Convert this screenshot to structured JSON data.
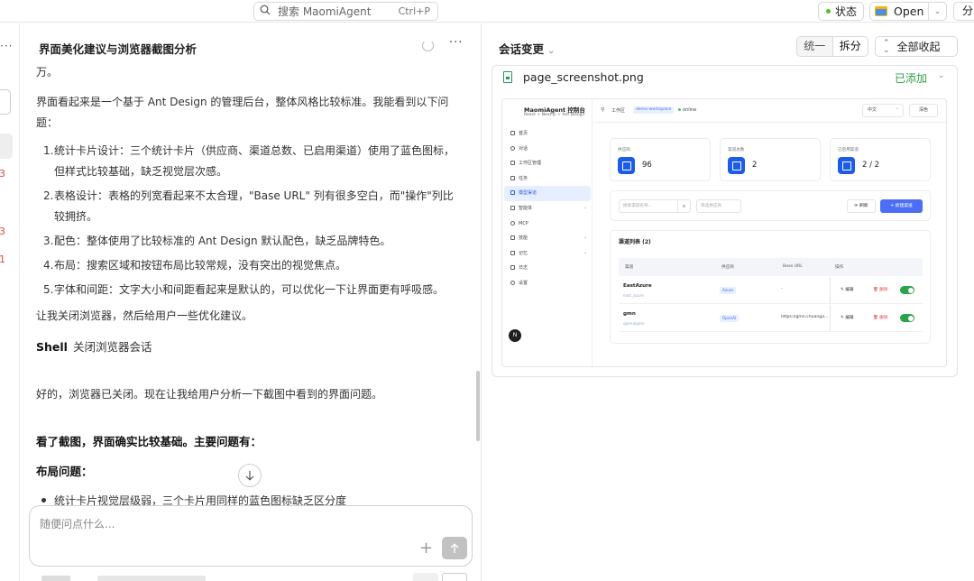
{
  "topbar": {
    "search_placeholder": "搜索 MaomiAgent",
    "search_shortcut": "Ctrl+P",
    "status_label": "状态",
    "open_label": "Open",
    "share_label": "分"
  },
  "left_strip": {
    "numbers": [
      "3",
      "3",
      "1"
    ]
  },
  "chat": {
    "title": "界面美化建议与浏览器截图分析",
    "p0": "万。",
    "p1": "界面看起来是一个基于 Ant Design 的管理后台，整体风格比较标准。我能看到以下问题：",
    "issues": [
      {
        "num": "1.",
        "text": "统计卡片设计：三个统计卡片（供应商、渠道总数、已启用渠道）使用了蓝色图标，但样式比较基础，缺乏视觉层次感。"
      },
      {
        "num": "2.",
        "text": "表格设计：表格的列宽看起来不太合理，\"Base URL\" 列有很多空白，而\"操作\"列比较拥挤。"
      },
      {
        "num": "3.",
        "text": "配色：整体使用了比较标准的 Ant Design 默认配色，缺乏品牌特色。"
      },
      {
        "num": "4.",
        "text": "布局：搜索区域和按钮布局比较常规，没有突出的视觉焦点。"
      },
      {
        "num": "5.",
        "text": "字体和间距：文字大小和间距看起来是默认的，可以优化一下让界面更有呼吸感。"
      }
    ],
    "p2": "让我关闭浏览器，然后给用户一些优化建议。",
    "shell_label": "Shell",
    "shell_text": "关闭浏览器会话",
    "p3": "好的，浏览器已关闭。现在让我给用户分析一下截图中看到的界面问题。",
    "p4": "看了截图，界面确实比较基础。主要问题有：",
    "p5": "布局问题：",
    "bullet1": "统计卡片视觉层级弱，三个卡片用同样的蓝色图标缺乏区分度",
    "composer_placeholder": "随便问点什么..."
  },
  "right": {
    "title": "会话变更",
    "seg_unified": "统一",
    "seg_split": "拆分",
    "collapse_all": "全部收起",
    "file_name": "page_screenshot.png",
    "file_status": "已添加"
  },
  "mini": {
    "logo": "MaomiAgent 控制台",
    "logo_sub": "React + Next.js + Ant Design",
    "nav": [
      {
        "label": "首页",
        "arrow": ""
      },
      {
        "label": "对话",
        "arrow": ""
      },
      {
        "label": "工作区管理",
        "arrow": ""
      },
      {
        "label": "任务",
        "arrow": ""
      },
      {
        "label": "模型渠道",
        "arrow": ""
      },
      {
        "label": "智能体",
        "arrow": "⌄"
      },
      {
        "label": "MCP",
        "arrow": ""
      },
      {
        "label": "技能",
        "arrow": "⌄"
      },
      {
        "label": "记忆",
        "arrow": "⌄"
      },
      {
        "label": "日志",
        "arrow": ""
      },
      {
        "label": "设置",
        "arrow": ""
      }
    ],
    "avatar": "N",
    "workspace_label": "工作区",
    "workspace_tag": "demo-workspace",
    "online": "online",
    "lang": "中文",
    "theme": "深色",
    "cards": [
      {
        "label": "供应商",
        "value": "96"
      },
      {
        "label": "渠道总数",
        "value": "2"
      },
      {
        "label": "已启用渠道",
        "value": "2 / 2"
      }
    ],
    "search_placeholder": "搜索渠道名称...",
    "filter_placeholder": "筛选供应商",
    "refresh": "刷新",
    "new_channel": "+ 新建渠道",
    "table_title": "渠道列表 (2)",
    "columns": [
      "渠道",
      "供应商",
      "Base URL",
      "操作"
    ],
    "rows": [
      {
        "name": "EastAzure",
        "sub": "east_azure",
        "provider": "Azure",
        "url": "-",
        "edit": "编辑",
        "delete": "删除"
      },
      {
        "name": "gmn",
        "sub": "openaigmn",
        "provider": "OpenAI",
        "url": "https://gmn.chuanga...",
        "edit": "编辑",
        "delete": "删除"
      }
    ]
  }
}
